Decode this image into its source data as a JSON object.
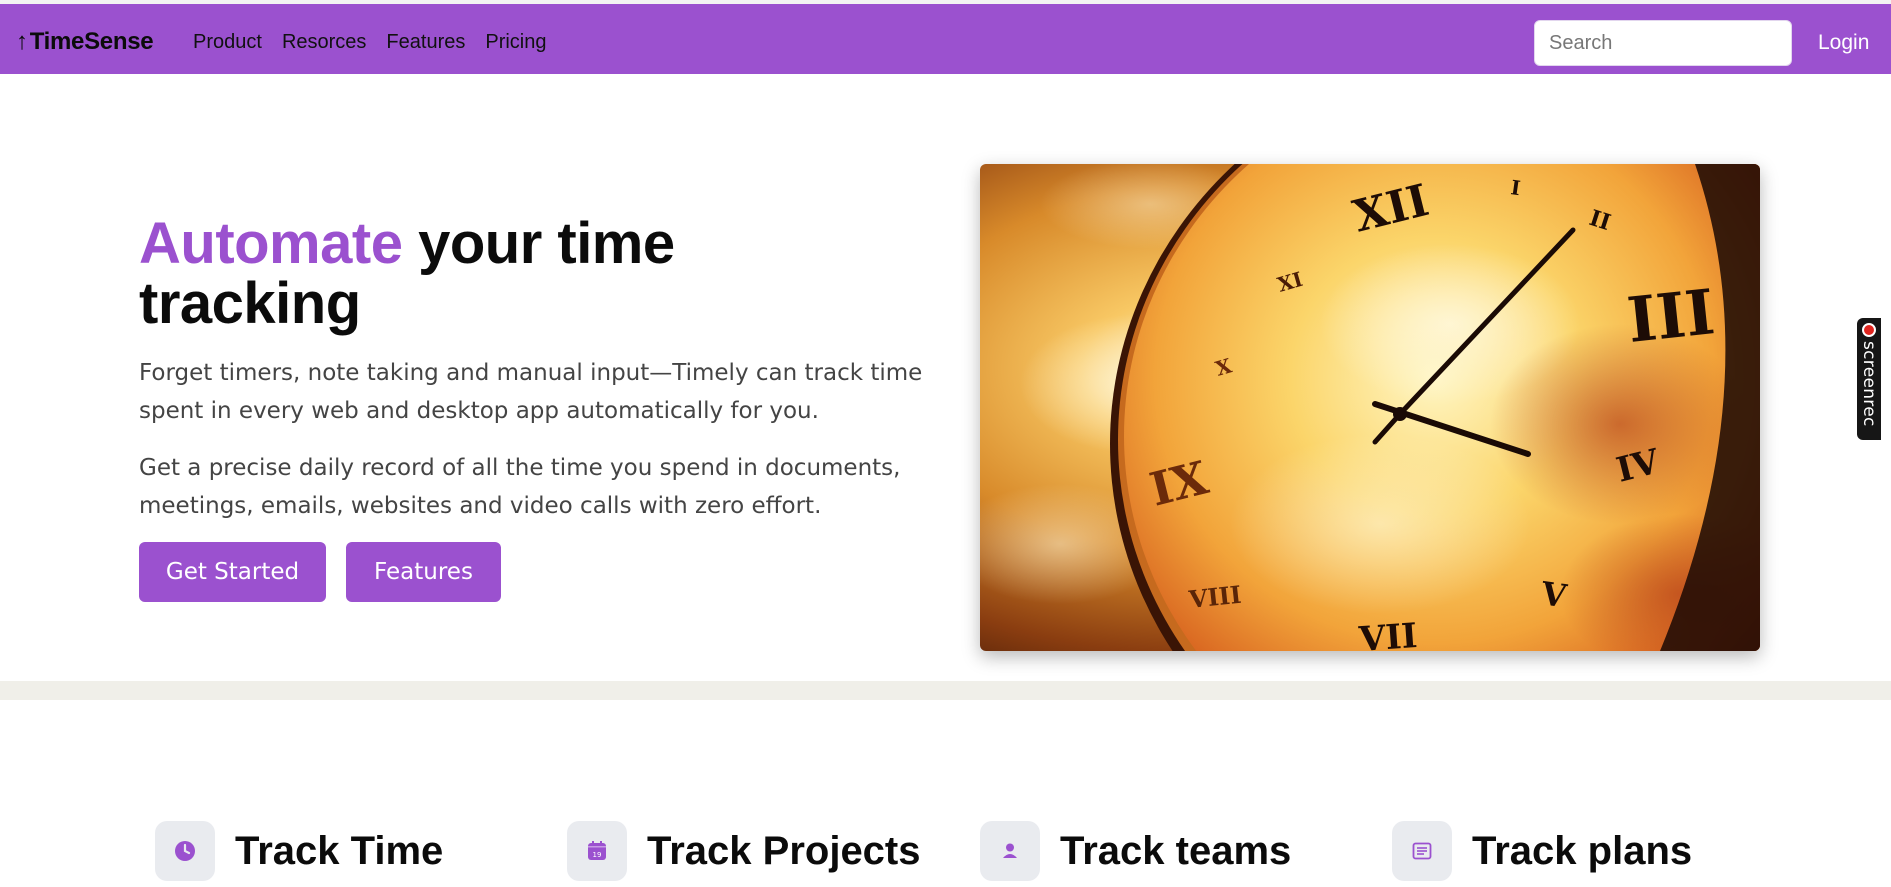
{
  "navbar": {
    "brand": "TimeSense",
    "brand_icon": "arrow-up-icon",
    "links": [
      "Product",
      "Resorces",
      "Features",
      "Pricing"
    ],
    "search_placeholder": "Search",
    "login_label": "Login",
    "bg_color": "#9b51cf"
  },
  "hero": {
    "title_accent": "Automate",
    "title_rest": " your time tracking",
    "paragraph1": "Forget timers, note taking and manual input—Timely can track time spent in every web and desktop app automatically for you.",
    "paragraph2": "Get a precise daily record of all the time you spend in documents, meetings, emails, websites and video calls with zero effort.",
    "primary_button": "Get Started",
    "secondary_button": "Features",
    "accent_color": "#9b51cf",
    "image": {
      "subject": "golden clock face with roman numerals against a fiery sky",
      "numerals": [
        "XII",
        "I",
        "II",
        "III",
        "IV",
        "V",
        "VIII",
        "IX",
        "X",
        "XI"
      ]
    }
  },
  "features": [
    {
      "title": "Track Time",
      "icon": "clock-icon"
    },
    {
      "title": "Track Projects",
      "icon": "calendar-icon",
      "icon_text": "19"
    },
    {
      "title": "Track teams",
      "icon": "person-icon"
    },
    {
      "title": "Track plans",
      "icon": "document-icon"
    }
  ],
  "screenrec_badge": {
    "label": "screenrec",
    "dot_color": "#e0251f"
  }
}
